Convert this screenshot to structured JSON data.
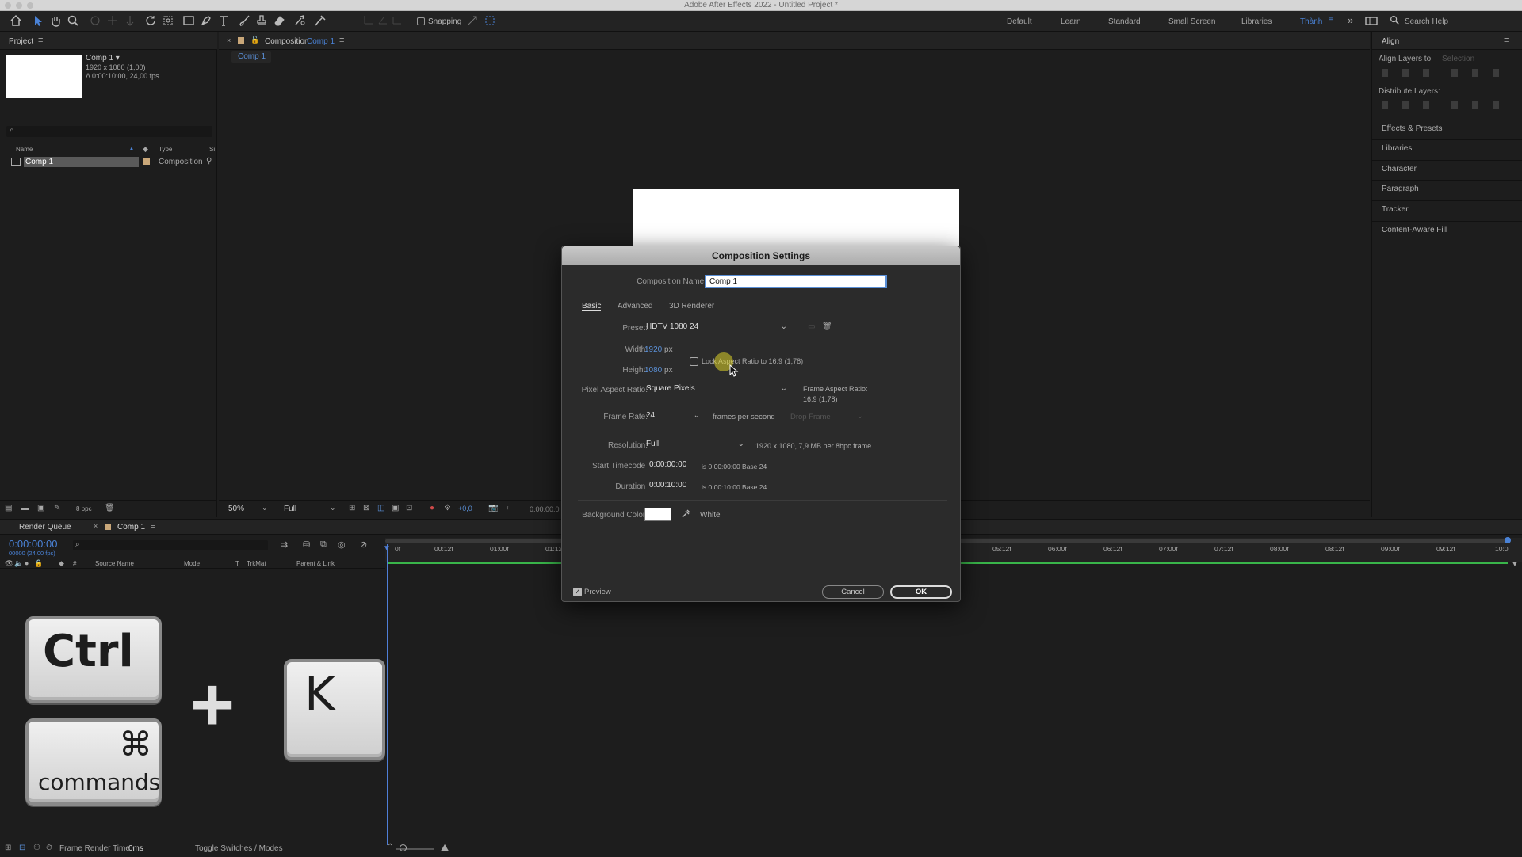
{
  "window": {
    "title": "Adobe After Effects 2022 - Untitled Project *"
  },
  "toolbar": {
    "snapping_label": "Snapping",
    "workspaces": [
      "Default",
      "Learn",
      "Standard",
      "Small Screen",
      "Libraries",
      "Thành"
    ],
    "search_placeholder": "Search Help"
  },
  "project_panel": {
    "title": "Project",
    "comp_name": "Comp 1 ▾",
    "comp_size": "1920 x 1080 (1,00)",
    "comp_duration": "Δ 0:00:10:00, 24,00 fps",
    "columns": {
      "name": "Name",
      "type": "Type",
      "size": "Si"
    },
    "rows": [
      {
        "name": "Comp 1",
        "type": "Composition"
      }
    ],
    "bpc": "8 bpc"
  },
  "composition_panel": {
    "tab_label": "Composition",
    "tab_comp": "Comp 1",
    "breadcrumb": "Comp 1",
    "zoom": "50%",
    "resolution": "Full",
    "exposure": "+0,0",
    "timecode": "0:00:00:0"
  },
  "right_panel": {
    "align_title": "Align",
    "align_layers_to": "Align Layers to:",
    "align_target": "Selection",
    "distribute_layers": "Distribute Layers:",
    "items": [
      "Effects & Presets",
      "Libraries",
      "Character",
      "Paragraph",
      "Tracker",
      "Content-Aware Fill"
    ]
  },
  "dialog": {
    "title": "Composition Settings",
    "comp_name_label": "Composition Name:",
    "comp_name_value": "Comp 1",
    "tabs": [
      "Basic",
      "Advanced",
      "3D Renderer"
    ],
    "preset_label": "Preset:",
    "preset_value": "HDTV 1080 24",
    "width_label": "Width:",
    "width_value": "1920",
    "height_label": "Height:",
    "height_value": "1080",
    "px_unit": "px",
    "lock_aspect_label": "Lock Aspect Ratio to 16:9 (1,78)",
    "par_label": "Pixel Aspect Ratio:",
    "par_value": "Square Pixels",
    "far_label": "Frame Aspect Ratio:",
    "far_value": "16:9 (1,78)",
    "frame_rate_label": "Frame Rate:",
    "frame_rate_value": "24",
    "fps_unit": "frames per second",
    "drop_frame": "Drop Frame",
    "resolution_label": "Resolution:",
    "resolution_value": "Full",
    "resolution_info": "1920 x 1080, 7,9 MB per 8bpc frame",
    "start_tc_label": "Start Timecode:",
    "start_tc_value": "0:00:00:00",
    "start_tc_info": "is 0:00:00:00  Base 24",
    "duration_label": "Duration:",
    "duration_value": "0:00:10:00",
    "duration_info": "is 0:00:10:00  Base 24",
    "bg_label": "Background Color:",
    "bg_name": "White",
    "preview_label": "Preview",
    "cancel_label": "Cancel",
    "ok_label": "OK"
  },
  "timeline": {
    "render_queue": "Render Queue",
    "comp_tab": "Comp 1",
    "timecode": "0:00:00:00",
    "timecode_sub": "00000 (24.00 fps)",
    "columns": {
      "source": "Source Name",
      "mode": "Mode",
      "t": "T",
      "trkmat": "TrkMat",
      "parent": "Parent & Link"
    },
    "ruler": [
      "0f",
      "00:12f",
      "01:00f",
      "01:12",
      "05:12f",
      "06:00f",
      "06:12f",
      "07:00f",
      "07:12f",
      "08:00f",
      "08:12f",
      "09:00f",
      "09:12f",
      "10:0"
    ],
    "frame_render_label": "Frame Render Time",
    "frame_render_value": "0ms",
    "toggle_label": "Toggle Switches / Modes"
  },
  "overlay": {
    "key_ctrl": "Ctrl",
    "key_cmd_symbol": "⌘",
    "key_cmd_label": "commands",
    "plus": "+",
    "key_k": "K"
  },
  "colors": {
    "accent_blue": "#4a82d6",
    "bg_white": "#ffffff",
    "playhead": "#4f7fd8",
    "work_area": "#39b54a"
  }
}
